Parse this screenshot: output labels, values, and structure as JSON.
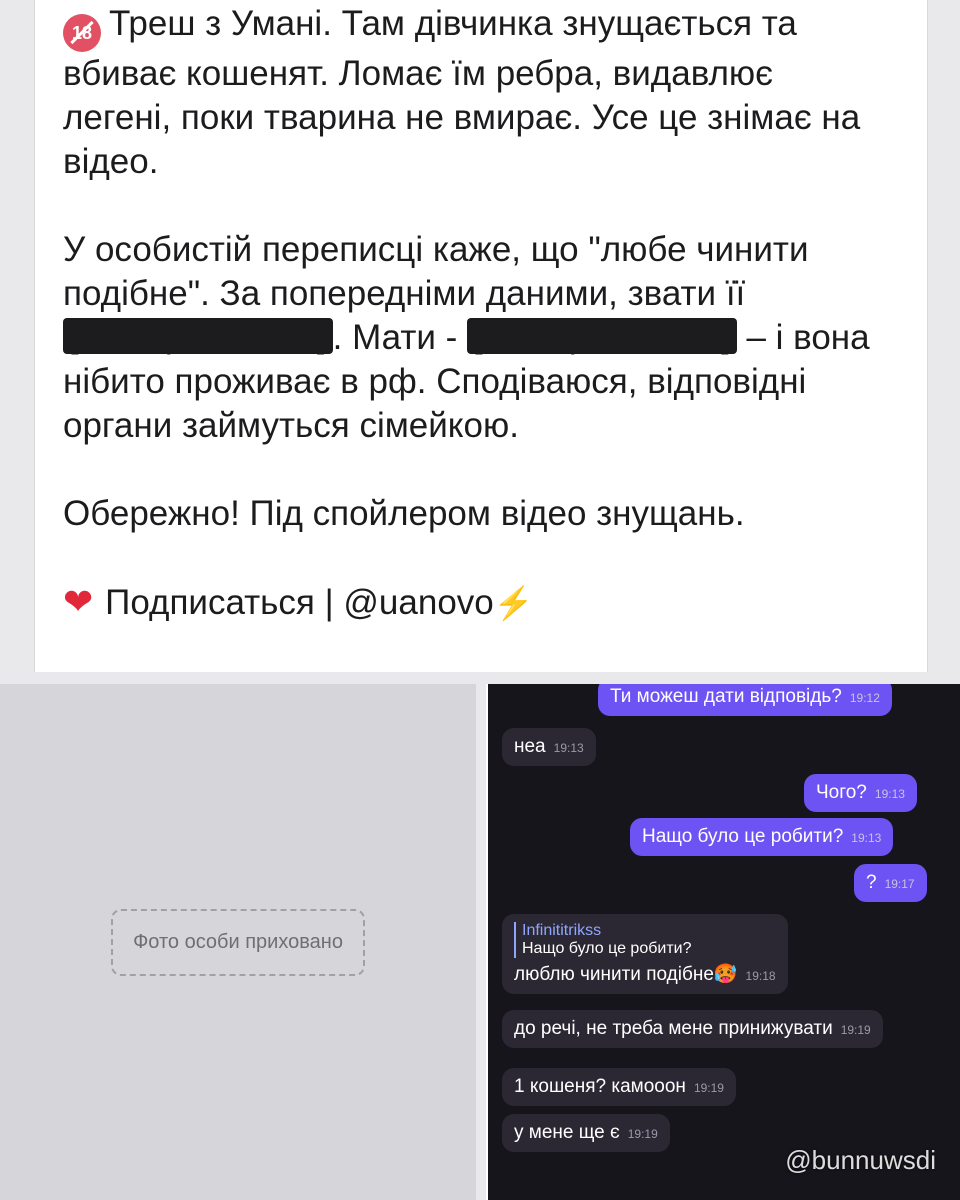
{
  "post": {
    "para1": "Треш з Умані. Там дівчинка знущається та вбиває кошенят. Ломає їм ребра, видавлює легені, поки тварина не вмирає. Усе це знімає на відео.",
    "para2_before": "У особистій переписці каже, що \"любе чинити подібне\". За попередніми даними, звати її",
    "para2_mid": ". Мати -",
    "para2_after": "– і вона нібито проживає в рф. Сподіваюся, відповідні органи займуться сімейкою.",
    "redacted_label": "[ім'я приховано]",
    "para3": "Обережно! Під спойлером відео знущань.",
    "subscribe": "Подписаться | @uanovo",
    "badge": "18"
  },
  "photo": {
    "placeholder": "Фото особи приховано"
  },
  "chat": {
    "messages": [
      {
        "text": "Ти можеш дати відповідь?",
        "time": "19:12"
      },
      {
        "text": "неа",
        "time": "19:13"
      },
      {
        "text": "Чого?",
        "time": "19:13"
      },
      {
        "text": "Нащо було це робити?",
        "time": "19:13"
      },
      {
        "text": "?",
        "time": "19:17"
      },
      {
        "quote_author": "Infinititrikss",
        "quote_text": "Нащо було це робити?",
        "text": "люблю чинити подібне🥵",
        "time": "19:18"
      },
      {
        "text": "до речі, не треба мене принижувати",
        "time": "19:19"
      },
      {
        "text": "1 кошеня? камооон",
        "time": "19:19"
      },
      {
        "text": "у мене ще є",
        "time": "19:19"
      }
    ]
  },
  "watermark": "@bunnuwsdi"
}
